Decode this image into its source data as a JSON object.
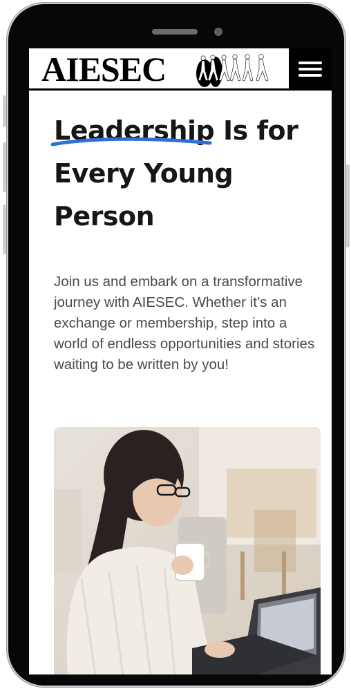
{
  "brand": {
    "logo_text": "AIESEC"
  },
  "hero": {
    "headline_highlight": "Leadership",
    "headline_rest_line1": " Is for",
    "headline_line2": "Every Young",
    "headline_line3": "Person",
    "description": "Join us and embark on a transformative journey with AIESEC. Whether it’s an exchange or membership, step into a world of endless opportunities and stories waiting to be written by you!"
  },
  "colors": {
    "accent_underline": "#2f6fd6",
    "text_dark": "#161616",
    "text_body": "#4a4a4a"
  },
  "icons": {
    "menu": "hamburger-menu-icon"
  }
}
